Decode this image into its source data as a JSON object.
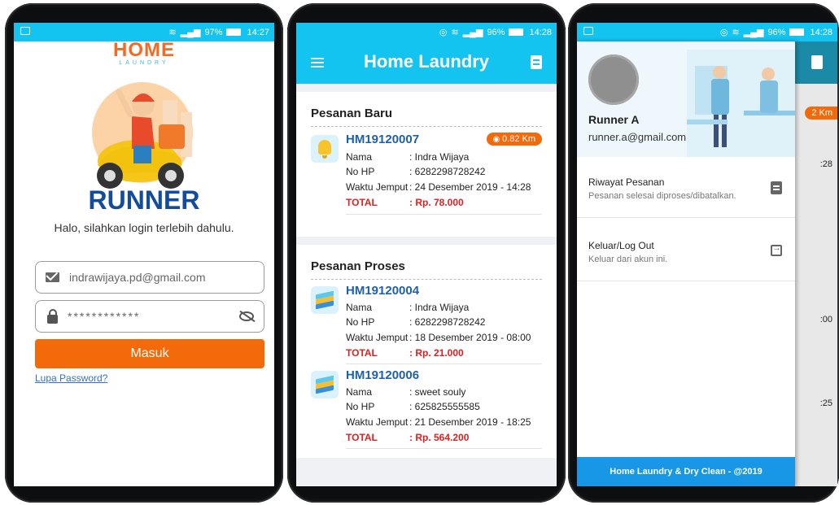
{
  "colors": {
    "accent": "#13c3f0",
    "brand_orange": "#f26a0a",
    "brand_blue": "#134c9e",
    "link": "#3170d6",
    "total_red": "#e02020"
  },
  "login": {
    "status": {
      "battery": "97%",
      "time": "14:27"
    },
    "logo": {
      "brand": "HOME",
      "sub": "LAUNDRY"
    },
    "title": "RUNNER",
    "greeting": "Halo, silahkan login terlebih dahulu.",
    "email_value": "indrawijaya.pd@gmail.com",
    "password_value": "************",
    "login_button": "Masuk",
    "forgot_link": "Lupa Password?",
    "icons": {
      "email": "mail-icon",
      "password": "lock-icon",
      "toggle": "eye-off-icon"
    }
  },
  "orders": {
    "status": {
      "battery": "96%",
      "time": "14:28"
    },
    "app_title": "Home Laundry",
    "new_section": {
      "title": "Pesanan Baru",
      "items": [
        {
          "code": "HM19120007",
          "distance": "0.82 Km",
          "name_label": "Nama",
          "name": ": Indra Wijaya",
          "phone_label": "No HP",
          "phone": ": 6282298728242",
          "pickup_label": "Waktu Jemput",
          "pickup": ": 24 Desember 2019 - 14:28",
          "total_label": "TOTAL",
          "total": ": Rp. 78.000"
        }
      ]
    },
    "process_section": {
      "title": "Pesanan Proses",
      "items": [
        {
          "code": "HM19120004",
          "name_label": "Nama",
          "name": ": Indra Wijaya",
          "phone_label": "No HP",
          "phone": ": 6282298728242",
          "pickup_label": "Waktu Jemput",
          "pickup": ": 18 Desember 2019 - 08:00",
          "total_label": "TOTAL",
          "total": ": Rp. 21.000"
        },
        {
          "code": "HM19120006",
          "name_label": "Nama",
          "name": ": sweet souly",
          "phone_label": "No HP",
          "phone": ": 625825555585",
          "pickup_label": "Waktu Jemput",
          "pickup": ": 21 Desember 2019 - 18:25",
          "total_label": "TOTAL",
          "total": ": Rp. 564.200"
        }
      ]
    }
  },
  "drawer": {
    "status": {
      "battery": "96%",
      "time": "14:28"
    },
    "user_name": "Runner A",
    "user_email": "runner.a@gmail.com",
    "menu": [
      {
        "title": "Riwayat Pesanan",
        "subtitle": "Pesanan selesai diproses/dibatalkan."
      },
      {
        "title": "Keluar/Log Out",
        "subtitle": "Keluar dari akun ini."
      }
    ],
    "footer": "Home Laundry & Dry Clean - @2019",
    "background_fragments": {
      "km": "2 Km",
      "t1": ":28",
      "t2": ":00",
      "t3": ":25"
    }
  }
}
